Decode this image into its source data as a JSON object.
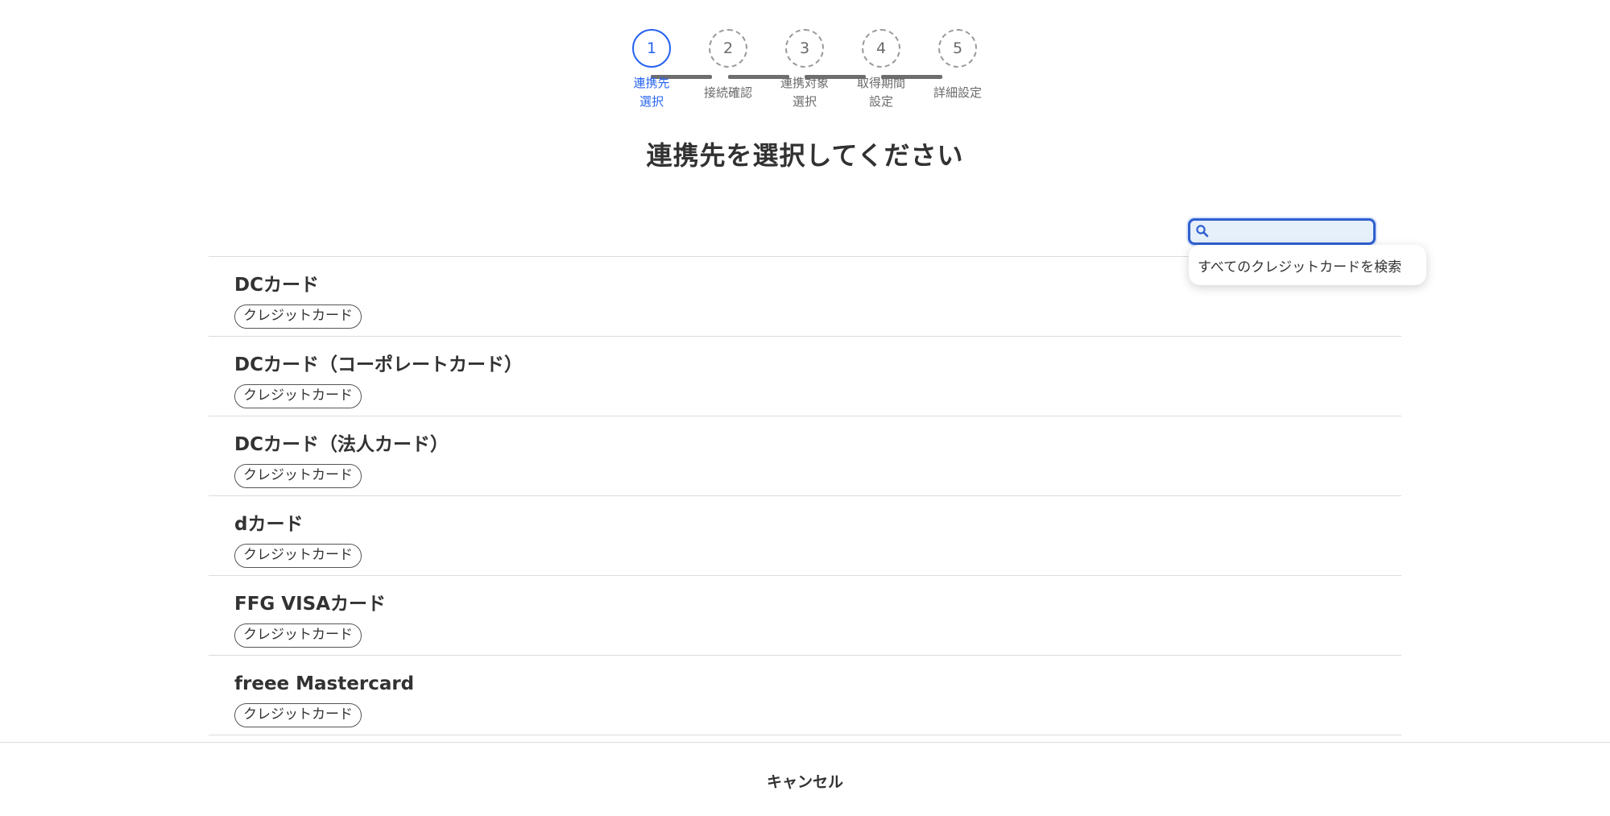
{
  "stepper": {
    "steps": [
      {
        "number": "1",
        "label": "連携先\n選択",
        "state": "active"
      },
      {
        "number": "2",
        "label": "接続確認",
        "state": "pending"
      },
      {
        "number": "3",
        "label": "連携対象\n選択",
        "state": "pending"
      },
      {
        "number": "4",
        "label": "取得期間\n設定",
        "state": "pending"
      },
      {
        "number": "5",
        "label": "詳細設定",
        "state": "pending"
      }
    ]
  },
  "page": {
    "title": "連携先を選択してください"
  },
  "search": {
    "value": "",
    "placeholder": "",
    "suggestion": "すべてのクレジットカードを検索"
  },
  "list": {
    "items": [
      {
        "name": "DCカード",
        "tag": "クレジットカード"
      },
      {
        "name": "DCカード（コーポレートカード）",
        "tag": "クレジットカード"
      },
      {
        "name": "DCカード（法人カード）",
        "tag": "クレジットカード"
      },
      {
        "name": "dカード",
        "tag": "クレジットカード"
      },
      {
        "name": "FFG VISAカード",
        "tag": "クレジットカード"
      },
      {
        "name": "freee Mastercard",
        "tag": "クレジットカード"
      }
    ]
  },
  "footer": {
    "cancel_label": "キャンセル"
  },
  "colors": {
    "accent": "#2864f0",
    "text": "#323232",
    "muted": "#6a6a6a",
    "divider": "#dcdcdc"
  }
}
